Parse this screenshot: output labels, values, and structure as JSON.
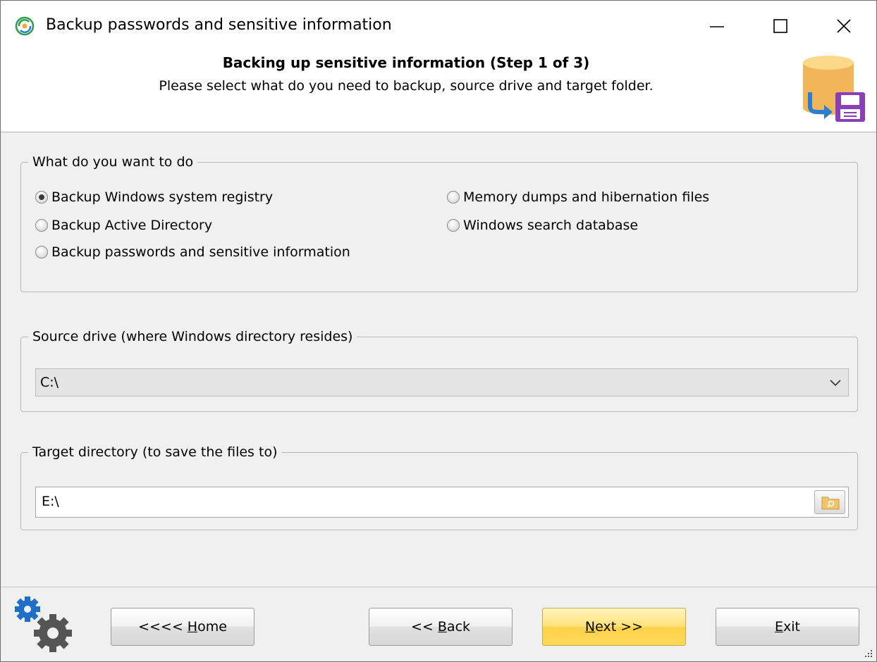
{
  "window": {
    "title": "Backup passwords and sensitive information",
    "controls": {
      "minimize": "minimize",
      "maximize": "maximize",
      "close": "close"
    }
  },
  "header": {
    "title": "Backing up sensitive information (Step 1 of 3)",
    "subtitle": "Please select what do you need to backup, source drive and target folder."
  },
  "action_group": {
    "legend": "What do you want to do",
    "options": [
      {
        "label": "Backup Windows system registry",
        "checked": true
      },
      {
        "label": "Backup Active Directory",
        "checked": false
      },
      {
        "label": "Backup passwords and sensitive information",
        "checked": false
      },
      {
        "label": "Memory dumps and hibernation files",
        "checked": false
      },
      {
        "label": "Windows search database",
        "checked": false
      }
    ]
  },
  "source_group": {
    "legend": "Source drive (where Windows directory resides)",
    "value": "C:\\"
  },
  "target_group": {
    "legend": "Target directory (to save the files to)",
    "value": "E:\\"
  },
  "footer": {
    "home": {
      "prefix": "<<<< ",
      "accel": "H",
      "rest": "ome"
    },
    "back": {
      "prefix": "<< ",
      "accel": "B",
      "rest": "ack"
    },
    "next": {
      "prefix": "",
      "accel": "N",
      "rest": "ext >>"
    },
    "exit": {
      "prefix": "",
      "accel": "E",
      "rest": "xit"
    }
  },
  "colors": {
    "primary_button": "#ffd24a",
    "window_bg": "#f0f0f0",
    "header_bg": "#ffffff"
  }
}
